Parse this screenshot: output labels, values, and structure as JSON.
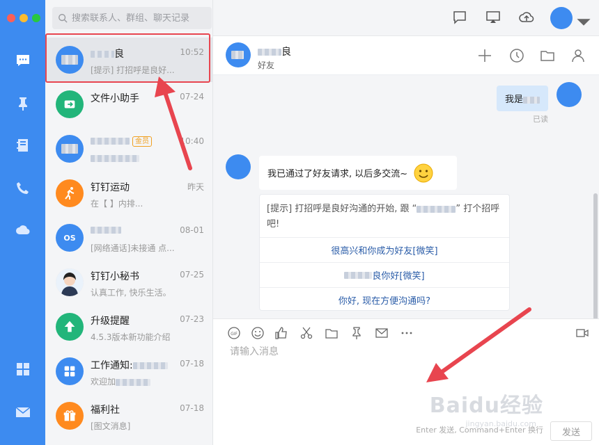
{
  "window": {
    "traffic_colors": [
      "#fc5f57",
      "#fdbc2e",
      "#28c840"
    ]
  },
  "search": {
    "placeholder": "搜索联系人、群组、聊天记录"
  },
  "conversations": [
    {
      "name": "良",
      "time": "10:52",
      "snippet": "[提示] 打招呼是良好...",
      "color": "#3d8bf0"
    },
    {
      "name": "文件小助手",
      "time": "07-24",
      "snippet": "",
      "color": "#22b57a"
    },
    {
      "name": "",
      "badge": "金员",
      "time": "10:40",
      "snippet": "",
      "color": "#3d8bf0"
    },
    {
      "name": "钉钉运动",
      "time": "昨天",
      "snippet": "在【 】内排...",
      "color": "#ff8a1f"
    },
    {
      "name": "",
      "avatar_text": "OS",
      "time": "08-01",
      "snippet": "[网络通话]未接通 点...",
      "color": "#3d8bf0"
    },
    {
      "name": "钉钉小秘书",
      "time": "07-25",
      "snippet": "认真工作, 快乐生活。",
      "color": "#f0d8c8"
    },
    {
      "name": "升级提醒",
      "time": "07-23",
      "snippet": "4.5.3版本新功能介绍",
      "color": "#22b57a"
    },
    {
      "name": "工作通知:",
      "time": "07-18",
      "snippet": "欢迎加",
      "color": "#3d8bf0"
    },
    {
      "name": "福利社",
      "time": "07-18",
      "snippet": "[图文消息]",
      "color": "#ff8a1f"
    }
  ],
  "chat": {
    "contact_name": "良",
    "contact_subtitle": "好友",
    "my_message": "我是",
    "read_status": "已读",
    "their_message": "我已通过了好友请求, 以后多交流~",
    "hint_text_1": "[提示] 打招呼是良好沟通的开始, 跟 “",
    "hint_text_2": "” 打个招呼吧!",
    "hint_options": [
      "很高兴和你成为好友[微笑]",
      "良你好[微笑]",
      "你好, 现在方便沟通吗?"
    ]
  },
  "input": {
    "placeholder": "请输入消息",
    "key_hint": "Enter 发送, Command+Enter 换行",
    "send_label": "发送"
  },
  "watermark": {
    "brand": "Baidu经验",
    "sub": "jingyan.baidu.com"
  },
  "colors": {
    "accent": "#3d8bf0",
    "highlight": "#e8454f"
  }
}
